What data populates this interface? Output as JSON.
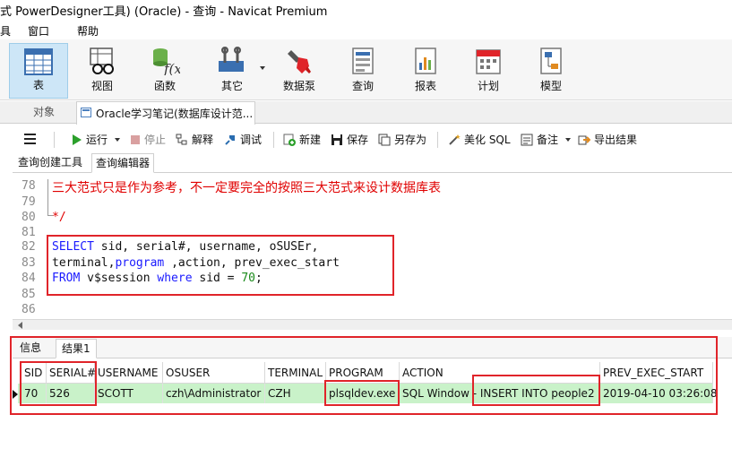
{
  "window": {
    "title": "式 PowerDesigner工具) (Oracle) - 查询 - Navicat Premium"
  },
  "menu": {
    "items": [
      "具",
      "窗口",
      "帮助"
    ]
  },
  "ribbon": {
    "buttons": [
      "表",
      "视图",
      "函数",
      "其它",
      "数据泵",
      "查询",
      "报表",
      "计划",
      "模型"
    ]
  },
  "tabs": {
    "objects": "对象",
    "query": "Oracle学习笔记(数据库设计范..."
  },
  "toolbar": {
    "run": "运行",
    "stop": "停止",
    "explain": "解释",
    "debug": "调试",
    "new": "新建",
    "save": "保存",
    "save_as": "另存为",
    "beautify": "美化 SQL",
    "note": "备注",
    "export": "导出结果"
  },
  "subtabs": {
    "builder": "查询创建工具",
    "editor": "查询编辑器"
  },
  "editor": {
    "lines": [
      {
        "num": "78",
        "text": "三大范式只是作为参考，不一定要完全的按照三大范式来设计数据库表"
      },
      {
        "num": "79",
        "text": ""
      },
      {
        "num": "80",
        "text": "*/"
      },
      {
        "num": "81",
        "text": ""
      },
      {
        "num": "82",
        "kw1": "SELECT",
        "rest": " sid, serial#, username, oSUSEr,"
      },
      {
        "num": "83",
        "pre": "terminal,",
        "kw1": "program",
        "rest": " ,action, prev_exec_start"
      },
      {
        "num": "84",
        "kw1": "FROM",
        "pre": " v$session ",
        "kw2": "where",
        "mid": " sid = ",
        "val": "70",
        "end": ";"
      },
      {
        "num": "85",
        "text": ""
      },
      {
        "num": "86",
        "text": ""
      }
    ]
  },
  "results": {
    "tabs": [
      "信息",
      "结果1"
    ],
    "columns": [
      "SID",
      "SERIAL#",
      "USERNAME",
      "OSUSER",
      "TERMINAL",
      "PROGRAM",
      "ACTION",
      "PREV_EXEC_START"
    ],
    "rows": [
      [
        "70",
        "526",
        "SCOTT",
        "czh\\Administrator",
        "CZH",
        "plsqldev.exe",
        "SQL Window - INSERT INTO people2",
        "2019-04-10 03:26:08"
      ]
    ]
  },
  "colors": {
    "highlight": "#e0242a",
    "row_selected": "#c9f2c9",
    "keyword": "#1a1aff",
    "comment": "#e00000"
  },
  "icons": [
    "table-icon",
    "view-icon",
    "function-icon",
    "other-icon",
    "datapump-icon",
    "query-icon",
    "report-icon",
    "schedule-icon",
    "model-icon"
  ]
}
